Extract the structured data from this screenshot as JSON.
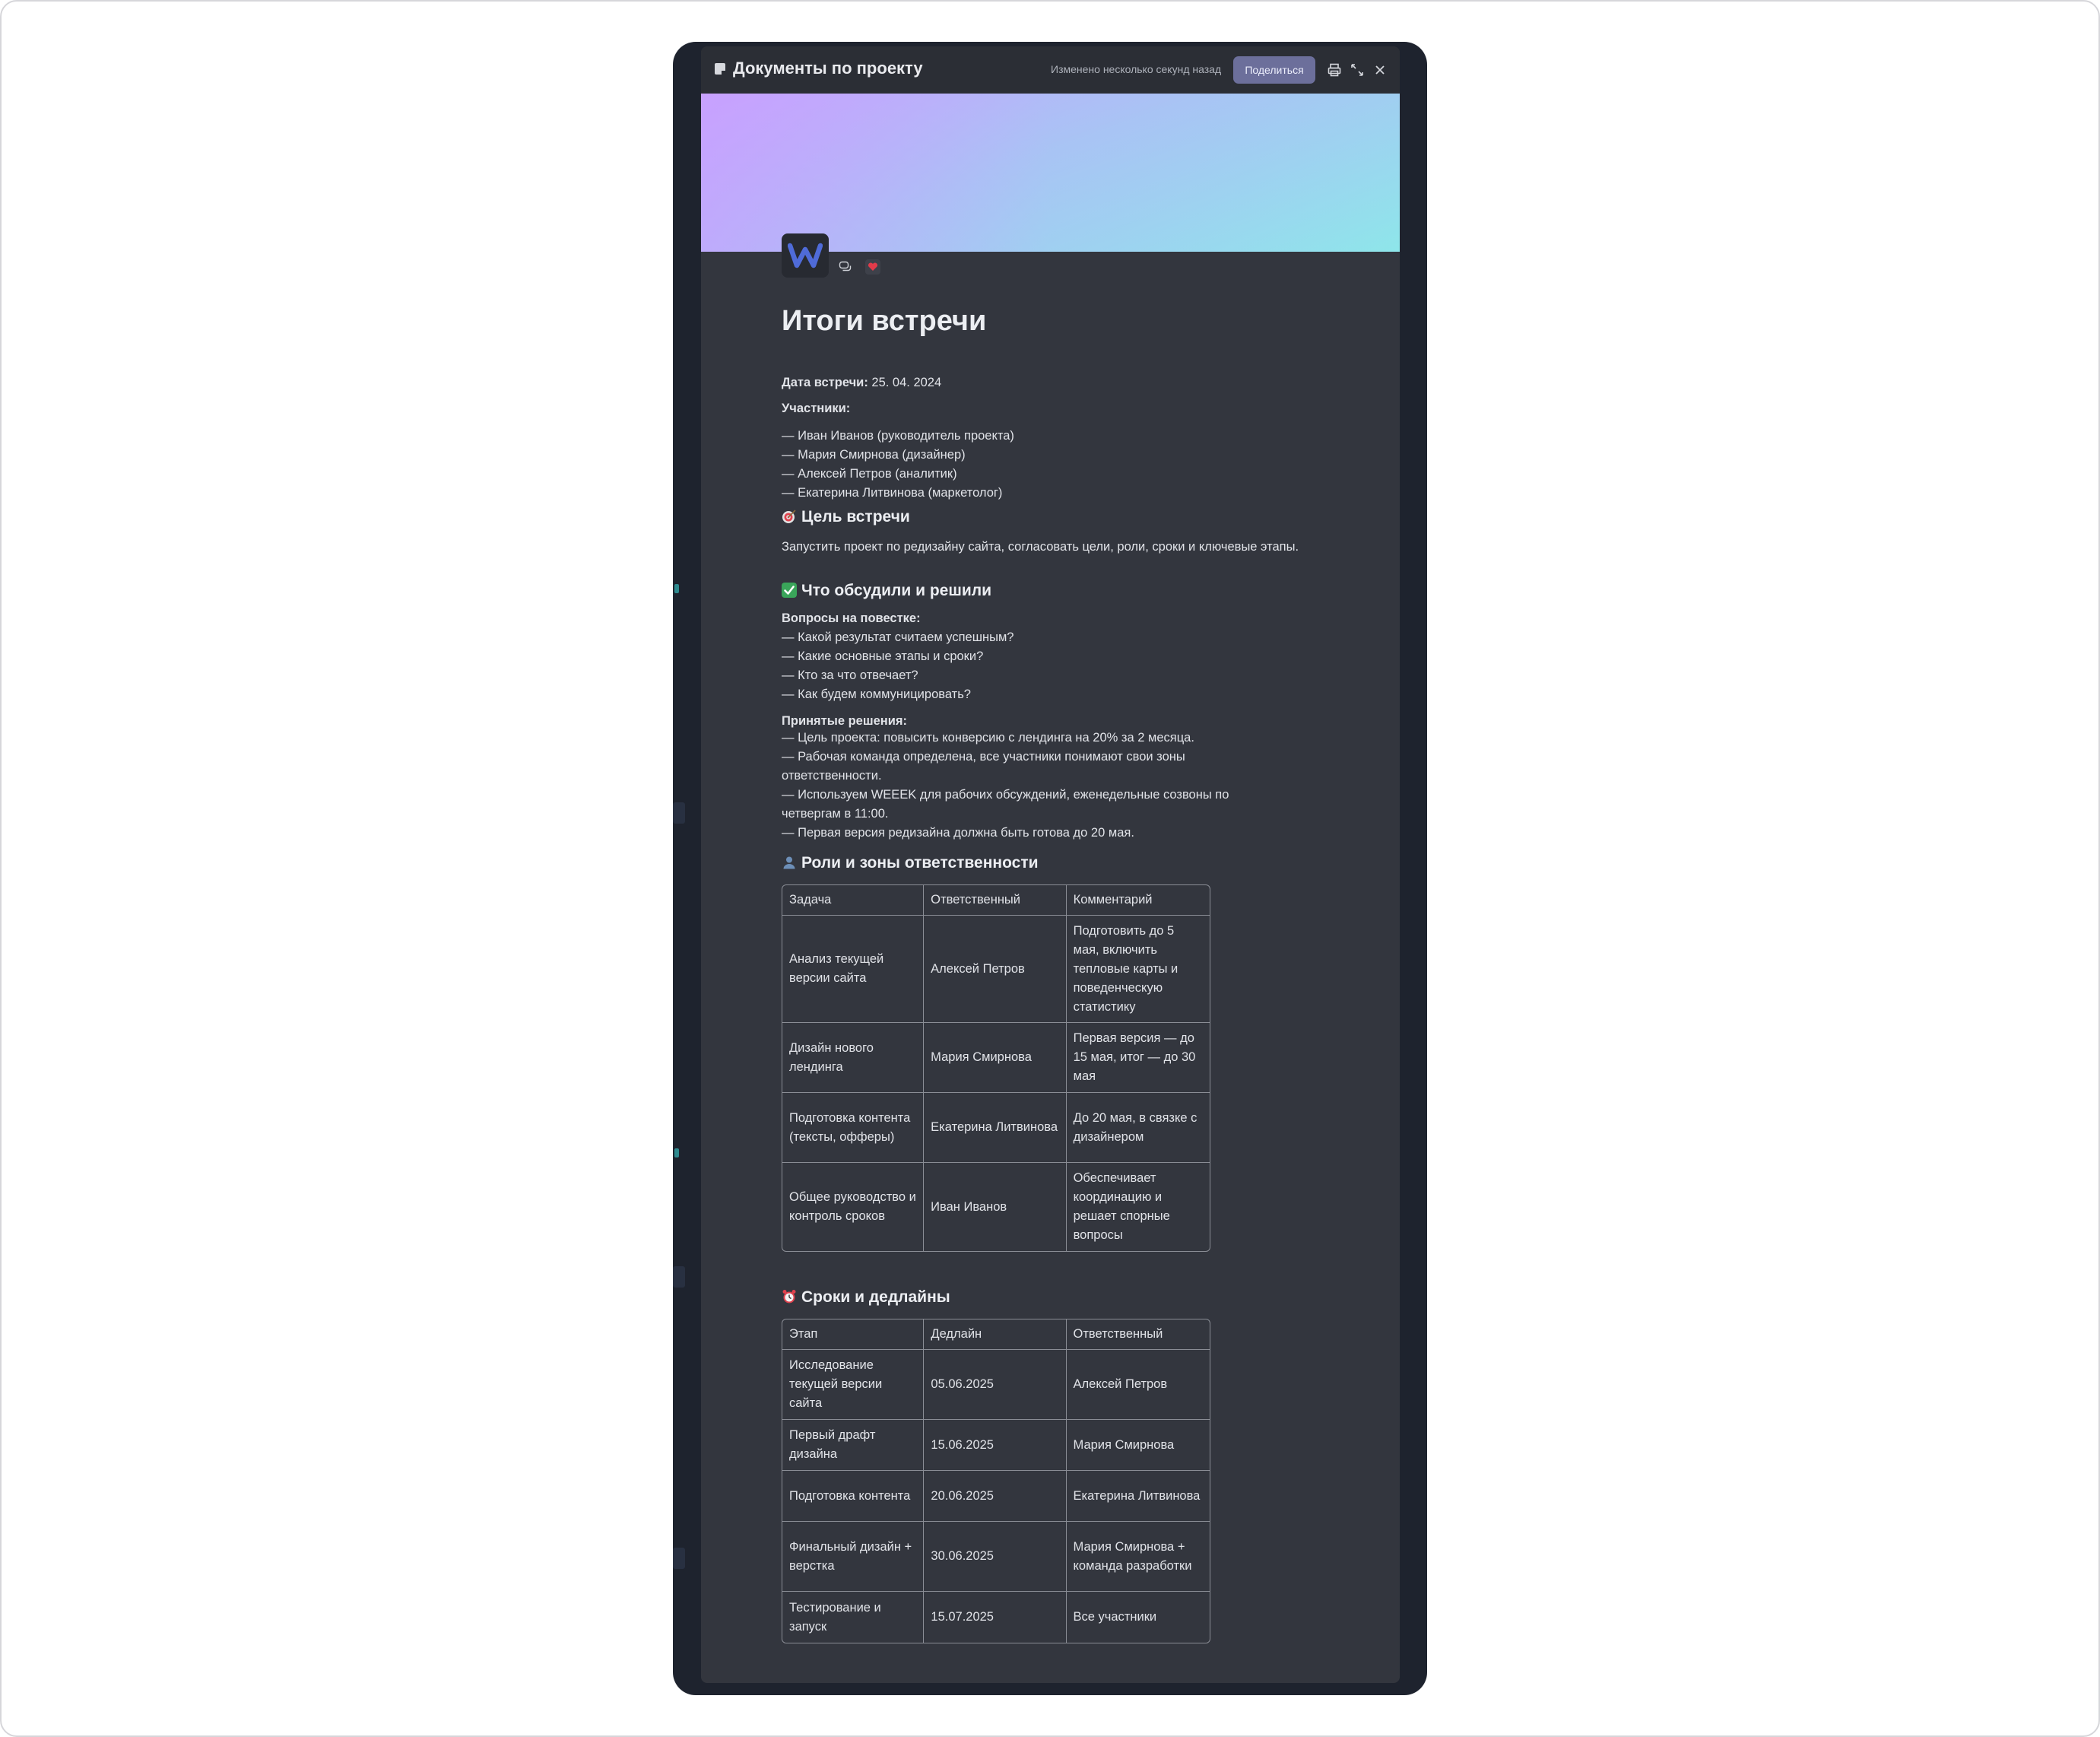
{
  "window": {
    "doc_title": "Документы по проекту",
    "modified": "Изменено несколько секунд назад",
    "share_label": "Поделиться"
  },
  "document": {
    "title": "Итоги встречи",
    "date_label": "Дата встречи:",
    "date_value": " 25. 04. 2024",
    "participants_label": "Участники:",
    "participants": [
      "— Иван Иванов (руководитель проекта)",
      "— Мария Смирнова (дизайнер)",
      "— Алексей Петров (аналитик)",
      "— Екатерина Литвинова (маркетолог)"
    ],
    "goal_heading": "Цель встречи",
    "goal_text": "Запустить проект по редизайну сайта, согласовать цели, роли, сроки и ключевые этапы.",
    "discussed_heading": "Что обсудили и решили",
    "agenda_label": "Вопросы на повестке:",
    "agenda": [
      "— Какой результат считаем успешным?",
      "— Какие основные этапы и сроки?",
      "— Кто за что отвечает?",
      "— Как будем коммуницировать?"
    ],
    "decisions_label": "Принятые решения:",
    "decisions": [
      "— Цель проекта: повысить конверсию с лендинга на 20% за 2 месяца.",
      "— Рабочая команда определена, все участники понимают свои зоны ответственности.",
      "— Используем WEEEK для рабочих обсуждений, еженедельные созвоны по четвергам в 11:00.",
      "— Первая версия редизайна должна быть готова до 20 мая."
    ],
    "roles_heading": "Роли и зоны ответственности",
    "roles_table": {
      "headers": [
        "Задача",
        "Ответственный",
        "Комментарий"
      ],
      "rows": [
        [
          "Анализ текущей версии сайта",
          "Алексей Петров",
          "Подготовить до 5 мая, включить тепловые карты и поведенческую статистику"
        ],
        [
          "Дизайн нового лендинга",
          "Мария Смирнова",
          "Первая версия — до 15 мая, итог — до 30 мая"
        ],
        [
          "Подготовка контента (тексты, офферы)",
          "Екатерина Литвинова",
          "До 20 мая, в связке с дизайнером"
        ],
        [
          "Общее руководство и контроль сроков",
          "Иван Иванов",
          "Обеспечивает координацию и решает спорные вопросы"
        ]
      ]
    },
    "deadlines_heading": "Сроки и дедлайны",
    "deadlines_table": {
      "headers": [
        "Этап",
        "Дедлайн",
        "Ответственный"
      ],
      "rows": [
        [
          "Исследование текущей версии сайта",
          "05.06.2025",
          "Алексей Петров"
        ],
        [
          "Первый драфт дизайна",
          "15.06.2025",
          "Мария Смирнова"
        ],
        [
          "Подготовка контента",
          "20.06.2025",
          "Екатерина Литвинова"
        ],
        [
          "Финальный дизайн + верстка",
          "30.06.2025",
          "Мария Смирнова + команда разработки"
        ],
        [
          "Тестирование и запуск",
          "15.07.2025",
          "Все участники"
        ]
      ]
    }
  },
  "icons": {
    "doc": "document-icon",
    "print": "print-icon",
    "expand": "expand-icon",
    "close": "close-icon",
    "comment": "comment-icon",
    "reaction": "heart-icon",
    "goal": "target-emoji",
    "done": "check-emoji",
    "roles": "person-emoji",
    "deadlines": "alarm-clock-emoji"
  },
  "colors": {
    "accent": "#6c6f9b",
    "panel_bg": "#33363e",
    "window_bg": "#1e232e",
    "logo_w": "#4f6bd8",
    "check_green": "#3aa55a"
  }
}
